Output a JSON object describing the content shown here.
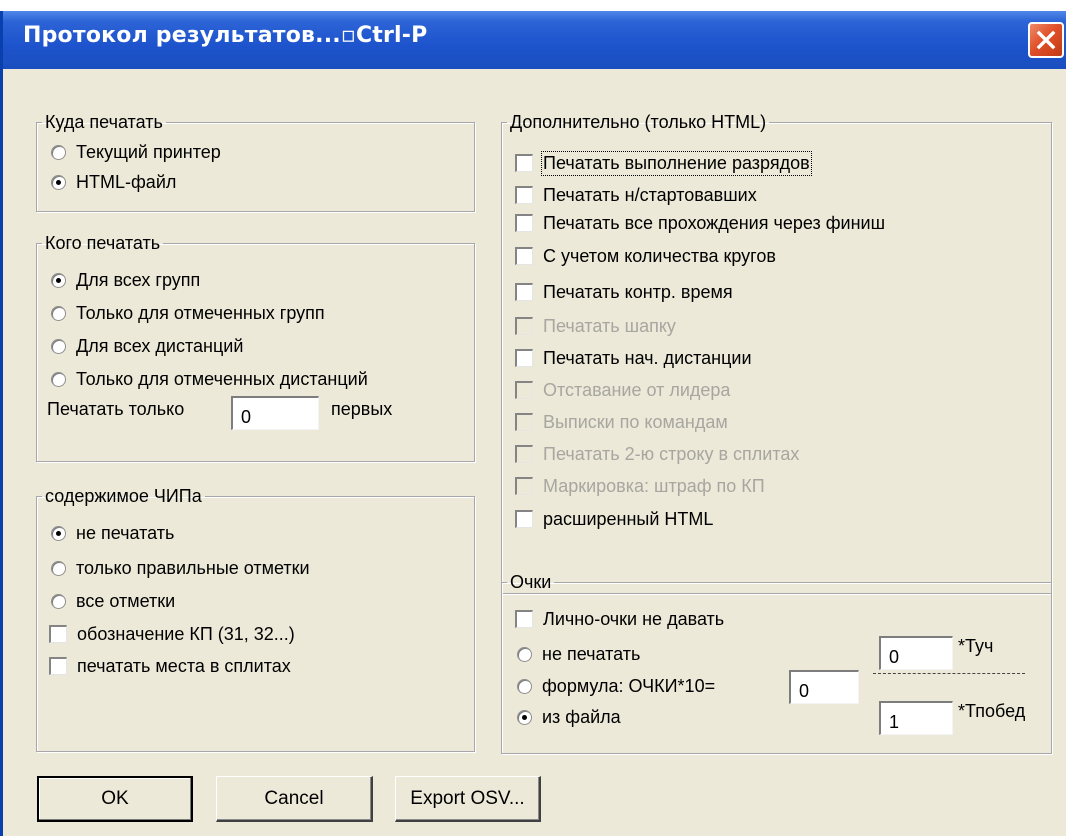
{
  "window": {
    "title": "Протокол результатов...▫Ctrl-P"
  },
  "where_group": {
    "legend": "Куда печатать",
    "options": [
      {
        "label": "Текущий принтер",
        "selected": false
      },
      {
        "label": "HTML-файл",
        "selected": true
      }
    ]
  },
  "whom_group": {
    "legend": "Кого печатать",
    "options": [
      {
        "label": "Для всех групп",
        "selected": true
      },
      {
        "label": "Только для отмеченных групп",
        "selected": false
      },
      {
        "label": "Для всех дистанций",
        "selected": false
      },
      {
        "label": "Только для отмеченных дистанций",
        "selected": false
      }
    ],
    "print_only_label": "Печатать только",
    "print_only_value": "0",
    "first_label": "первых"
  },
  "chip_group": {
    "legend": "содержимое ЧИПа",
    "options": [
      {
        "label": "не печатать",
        "selected": true
      },
      {
        "label": "только правильные отметки",
        "selected": false
      },
      {
        "label": "все отметки",
        "selected": false
      }
    ],
    "checkboxes": [
      {
        "label": "обозначение КП (31, 32...)",
        "checked": false
      },
      {
        "label": "печатать места в сплитах",
        "checked": false
      }
    ]
  },
  "extra_group": {
    "legend": "Дополнительно (только HTML)",
    "checkboxes": [
      {
        "label": "Печатать выполнение разрядов",
        "checked": false,
        "enabled": true
      },
      {
        "label": "Печатать н/стартовавших",
        "checked": false,
        "enabled": true
      },
      {
        "label": "Печатать все прохождения через финиш",
        "checked": false,
        "enabled": true
      },
      {
        "label": "С учетом количества кругов",
        "checked": false,
        "enabled": true
      },
      {
        "label": "Печатать контр. время",
        "checked": false,
        "enabled": true
      },
      {
        "label": "Печатать шапку",
        "checked": false,
        "enabled": false
      },
      {
        "label": "Печатать нач. дистанции",
        "checked": false,
        "enabled": true
      },
      {
        "label": "Отставание от лидера",
        "checked": false,
        "enabled": false
      },
      {
        "label": "Выписки по командам",
        "checked": false,
        "enabled": false
      },
      {
        "label": "Печатать 2-ю строку в сплитах",
        "checked": false,
        "enabled": false
      },
      {
        "label": "Маркировка: штраф по КП",
        "checked": false,
        "enabled": false
      },
      {
        "label": "расширенный HTML",
        "checked": false,
        "enabled": true
      }
    ]
  },
  "points_group": {
    "legend": "Очки",
    "no_personal_points_label": "Лично-очки не давать",
    "options": [
      {
        "label": "не печатать",
        "selected": false
      },
      {
        "label": "формула: ОЧКИ*10=",
        "selected": false
      },
      {
        "label": "из файла",
        "selected": true
      }
    ],
    "formula_value": "0",
    "tuch_value": "0",
    "tuch_label": "*Туч",
    "tpobed_value": "1",
    "tpobed_label": "*Тпобед"
  },
  "buttons": {
    "ok": "OK",
    "cancel": "Cancel",
    "export": "Export OSV..."
  },
  "colors": {
    "title_bar": "#1d53cc",
    "dialog_bg": "#ece9d8",
    "close_button": "#e0502a",
    "disabled_text": "#a7a6a0",
    "corner_mark": "#e61e10"
  }
}
